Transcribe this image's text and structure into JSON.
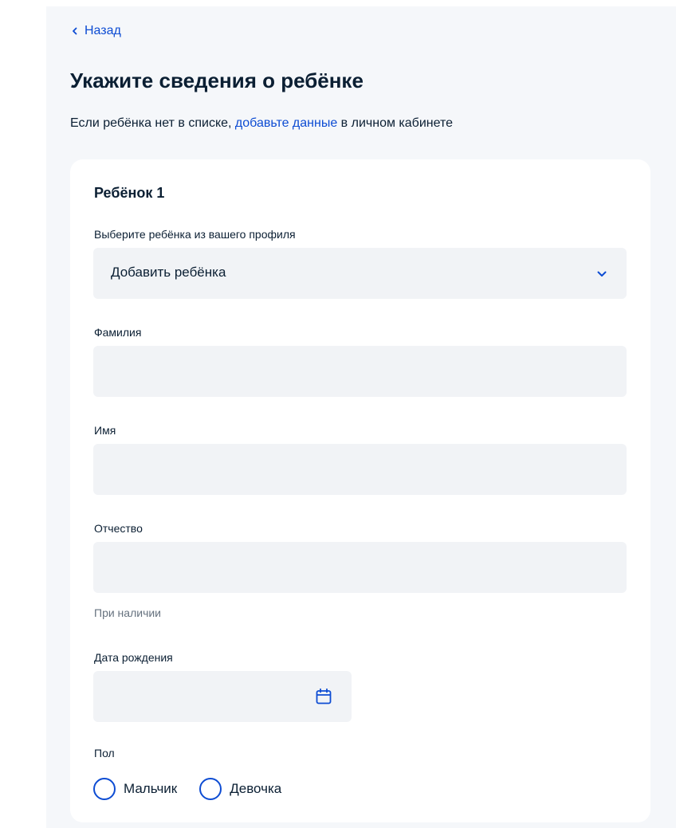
{
  "nav": {
    "back_label": "Назад"
  },
  "page": {
    "title": "Укажите сведения о ребёнке",
    "subtitle_before": "Если ребёнка нет в списке, ",
    "subtitle_link": "добавьте данные",
    "subtitle_after": " в личном кабинете"
  },
  "card": {
    "title": "Ребёнок 1",
    "child_select": {
      "label": "Выберите ребёнка из вашего профиля",
      "value": "Добавить ребёнка"
    },
    "surname": {
      "label": "Фамилия",
      "value": ""
    },
    "name": {
      "label": "Имя",
      "value": ""
    },
    "patronymic": {
      "label": "Отчество",
      "value": "",
      "hint": "При наличии"
    },
    "birth_date": {
      "label": "Дата рождения",
      "value": ""
    },
    "gender": {
      "label": "Пол",
      "options": [
        "Мальчик",
        "Девочка"
      ]
    }
  },
  "icons": {
    "back": "chevron-left-icon",
    "select": "chevron-down-icon",
    "date": "calendar-icon"
  },
  "colors": {
    "accent": "#0d4cd3",
    "text": "#0b1f33",
    "hint": "#66727f",
    "field_bg": "#f1f3f6",
    "page_bg": "#f5f7fa",
    "card_bg": "#ffffff"
  }
}
